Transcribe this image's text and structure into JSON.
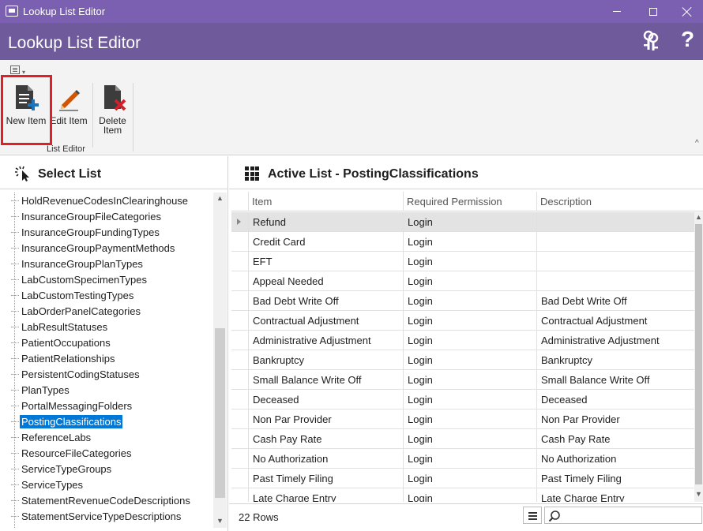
{
  "window": {
    "title": "Lookup List Editor"
  },
  "header": {
    "title": "Lookup List Editor"
  },
  "ribbon": {
    "buttons": [
      {
        "label": "New Item"
      },
      {
        "label": "Edit Item"
      },
      {
        "label": "Delete Item",
        "label_line1": "Delete",
        "label_line2": "Item"
      }
    ],
    "group_label": "List Editor"
  },
  "left_panel": {
    "title": "Select List",
    "items": [
      "HoldRevenueCodesInClearinghouse",
      "InsuranceGroupFileCategories",
      "InsuranceGroupFundingTypes",
      "InsuranceGroupPaymentMethods",
      "InsuranceGroupPlanTypes",
      "LabCustomSpecimenTypes",
      "LabCustomTestingTypes",
      "LabOrderPanelCategories",
      "LabResultStatuses",
      "PatientOccupations",
      "PatientRelationships",
      "PersistentCodingStatuses",
      "PlanTypes",
      "PortalMessagingFolders",
      "PostingClassifications",
      "ReferenceLabs",
      "ResourceFileCategories",
      "ServiceTypeGroups",
      "ServiceTypes",
      "StatementRevenueCodeDescriptions",
      "StatementServiceTypeDescriptions"
    ],
    "selected": "PostingClassifications"
  },
  "right_panel": {
    "title": "Active List - PostingClassifications",
    "columns": [
      "Item",
      "Required Permission",
      "Description"
    ],
    "rows": [
      [
        "Refund",
        "Login",
        ""
      ],
      [
        "Credit Card",
        "Login",
        ""
      ],
      [
        "EFT",
        "Login",
        ""
      ],
      [
        "Appeal Needed",
        "Login",
        ""
      ],
      [
        "Bad Debt Write Off",
        "Login",
        "Bad Debt Write Off"
      ],
      [
        "Contractual Adjustment",
        "Login",
        "Contractual Adjustment"
      ],
      [
        "Administrative Adjustment",
        "Login",
        "Administrative Adjustment"
      ],
      [
        "Bankruptcy",
        "Login",
        "Bankruptcy"
      ],
      [
        "Small Balance Write Off",
        "Login",
        "Small Balance Write Off"
      ],
      [
        "Deceased",
        "Login",
        "Deceased"
      ],
      [
        "Non Par Provider",
        "Login",
        "Non Par Provider"
      ],
      [
        "Cash Pay Rate",
        "Login",
        "Cash Pay Rate"
      ],
      [
        "No Authorization",
        "Login",
        "No Authorization"
      ],
      [
        "Past Timely Filing",
        "Login",
        "Past Timely Filing"
      ],
      [
        "Late Charge Entry",
        "Login",
        "Late Charge Entry"
      ]
    ],
    "row_count": "22 Rows",
    "search": {
      "value": ""
    }
  }
}
